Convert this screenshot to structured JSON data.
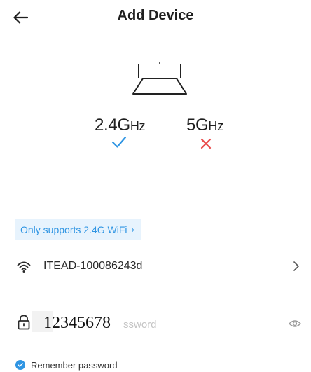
{
  "header": {
    "title": "Add Device",
    "back_icon": "arrow-left-icon"
  },
  "bands": [
    {
      "name": "2.4G",
      "unit": "Hz",
      "supported": true,
      "mark_icon": "check-icon",
      "color": "#2f95e3"
    },
    {
      "name": "5G",
      "unit": "Hz",
      "supported": false,
      "mark_icon": "cross-icon",
      "color": "#e94b4b"
    }
  ],
  "notice": {
    "text": "Only supports 2.4G WiFi",
    "chevron": "›"
  },
  "wifi": {
    "icon": "wifi-icon",
    "ssid": "ITEAD-100086243d",
    "chevron": "›"
  },
  "password": {
    "icon": "lock-icon",
    "value": "12345678",
    "placeholder_fragment": "ssword",
    "toggle_icon": "eye-icon"
  },
  "remember": {
    "checked": true,
    "label": "Remember password"
  },
  "colors": {
    "accent": "#2f95e3",
    "notice_bg": "#e7f3fd",
    "error": "#e94b4b"
  }
}
